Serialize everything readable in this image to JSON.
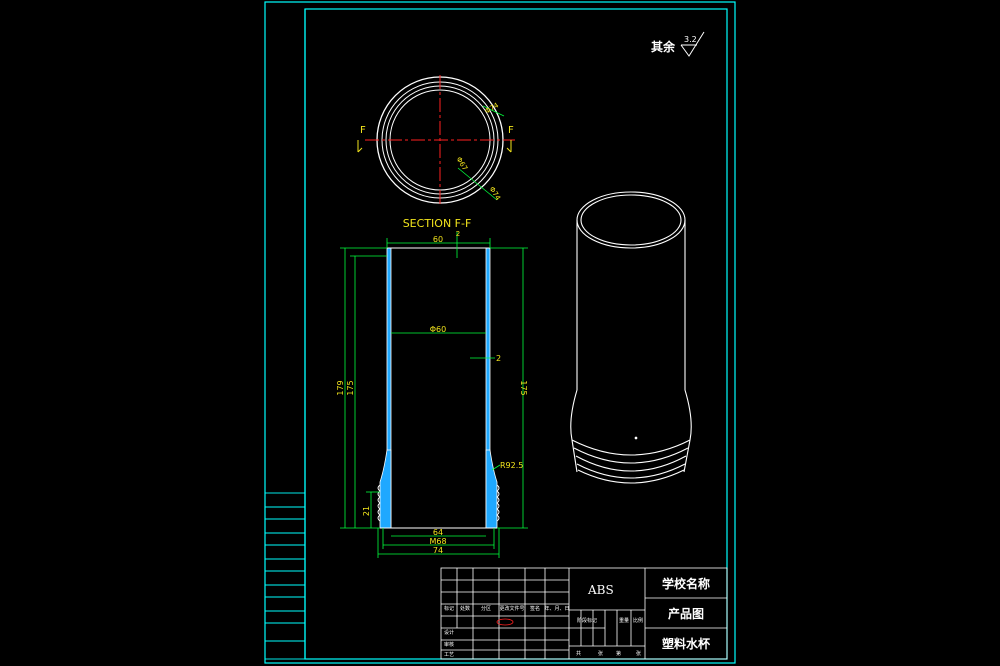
{
  "roughness": {
    "label": "其余",
    "value": "3.2"
  },
  "top_view": {
    "section_mark": "F",
    "dims": {
      "outer_top": "Φ74",
      "inner": "Φ67",
      "outer_bottom": "Φ74"
    }
  },
  "section": {
    "title": "SECTION F-F",
    "dims": {
      "top_width": "60",
      "top_gap": "2",
      "inner_dia": "Φ60",
      "wall": "2",
      "height_total": "179",
      "height_inner": "175",
      "height_right": "175",
      "radius": "R92.5",
      "thread_h": "21",
      "bottom_width": "64",
      "thread_dia": "M68",
      "overall_width": "74"
    }
  },
  "side_column": {
    "labels": [
      "",
      "",
      "",
      "",
      "",
      ""
    ]
  },
  "title_block": {
    "material": "ABS",
    "school": "学校名称",
    "drawing_type": "产品图",
    "part_name": "塑料水杯",
    "row_labels": [
      "标记",
      "处数",
      "分区",
      "更改文件号",
      "签名",
      "年、月、日"
    ],
    "row_labels2": [
      "设计",
      "审核",
      "工艺"
    ],
    "row_labels3": [
      "阶段标记",
      "重量",
      "比例"
    ],
    "bottom_labels": [
      "共",
      "张",
      "第",
      "张"
    ]
  },
  "colors": {
    "frame": "#00ffff",
    "outline": "#ffffff",
    "dimension": "#00ff3c",
    "dim_text": "#f2e41c",
    "center": "#ff2020",
    "hatch": "#1fa8ff"
  }
}
